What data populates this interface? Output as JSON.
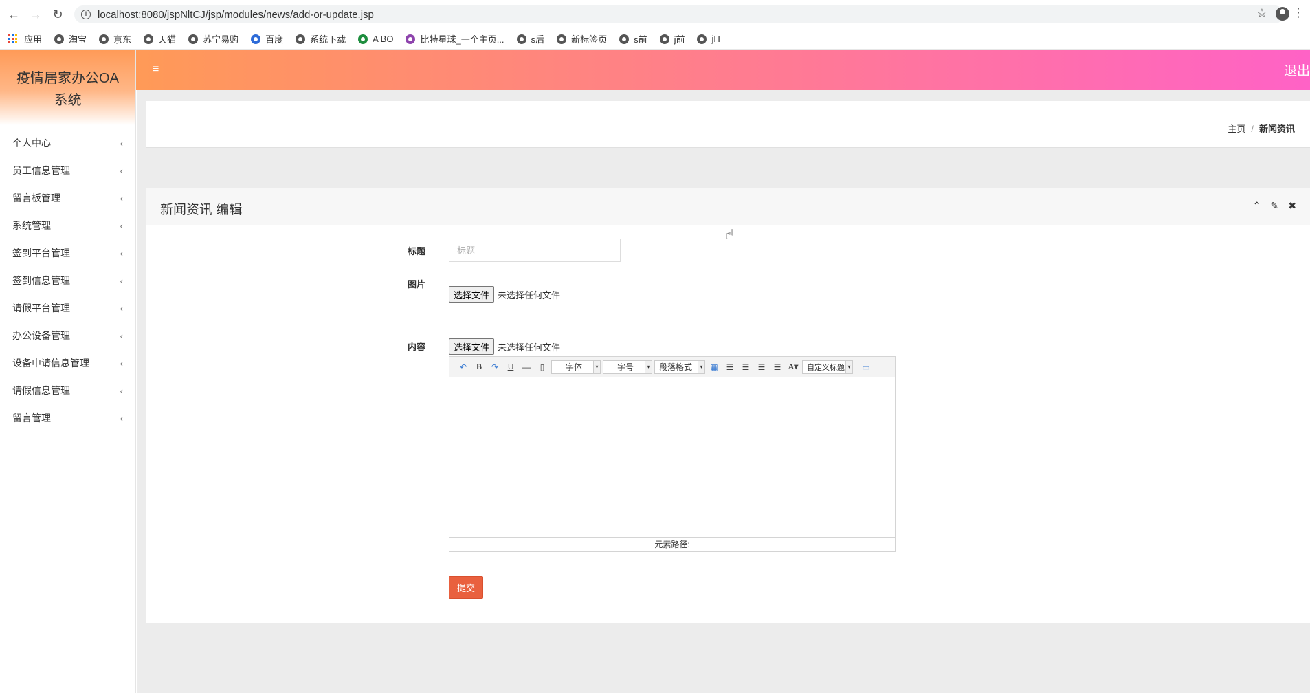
{
  "browser": {
    "url": "localhost:8080/jspNltCJ/jsp/modules/news/add-or-update.jsp",
    "bookmarks": [
      "应用",
      "淘宝",
      "京东",
      "天猫",
      "苏宁易购",
      "百度",
      "系统下载",
      "A BO",
      "比特星球_一个主页...",
      "s后",
      "新标签页",
      "s前",
      "j前",
      "jH"
    ]
  },
  "header": {
    "menu_toggle": "≡",
    "logout": "退出"
  },
  "sidebar": {
    "brand": "疫情居家办公OA系统",
    "items": [
      {
        "label": "个人中心"
      },
      {
        "label": "员工信息管理"
      },
      {
        "label": "留言板管理"
      },
      {
        "label": "系统管理"
      },
      {
        "label": "签到平台管理"
      },
      {
        "label": "签到信息管理"
      },
      {
        "label": "请假平台管理"
      },
      {
        "label": "办公设备管理"
      },
      {
        "label": "设备申请信息管理"
      },
      {
        "label": "请假信息管理"
      },
      {
        "label": "留言管理"
      }
    ]
  },
  "breadcrumb": {
    "home": "主页",
    "sep": "/",
    "current": "新闻资讯"
  },
  "panel": {
    "title": "新闻资讯 编辑"
  },
  "form": {
    "title_label": "标题",
    "title_placeholder": "标题",
    "image_label": "图片",
    "content_label": "内容",
    "file_button": "选择文件",
    "no_file": "未选择任何文件",
    "submit": "提交"
  },
  "editor": {
    "font_select": "字体",
    "size_select": "字号",
    "paragraph_select": "段落格式",
    "custom_title_select": "自定义标题",
    "status": "元素路径:"
  },
  "theme": {
    "header_gradient": [
      "#ff9a57",
      "#ff7d8e",
      "#ff62c6"
    ],
    "submit_color": "#e9603e"
  }
}
